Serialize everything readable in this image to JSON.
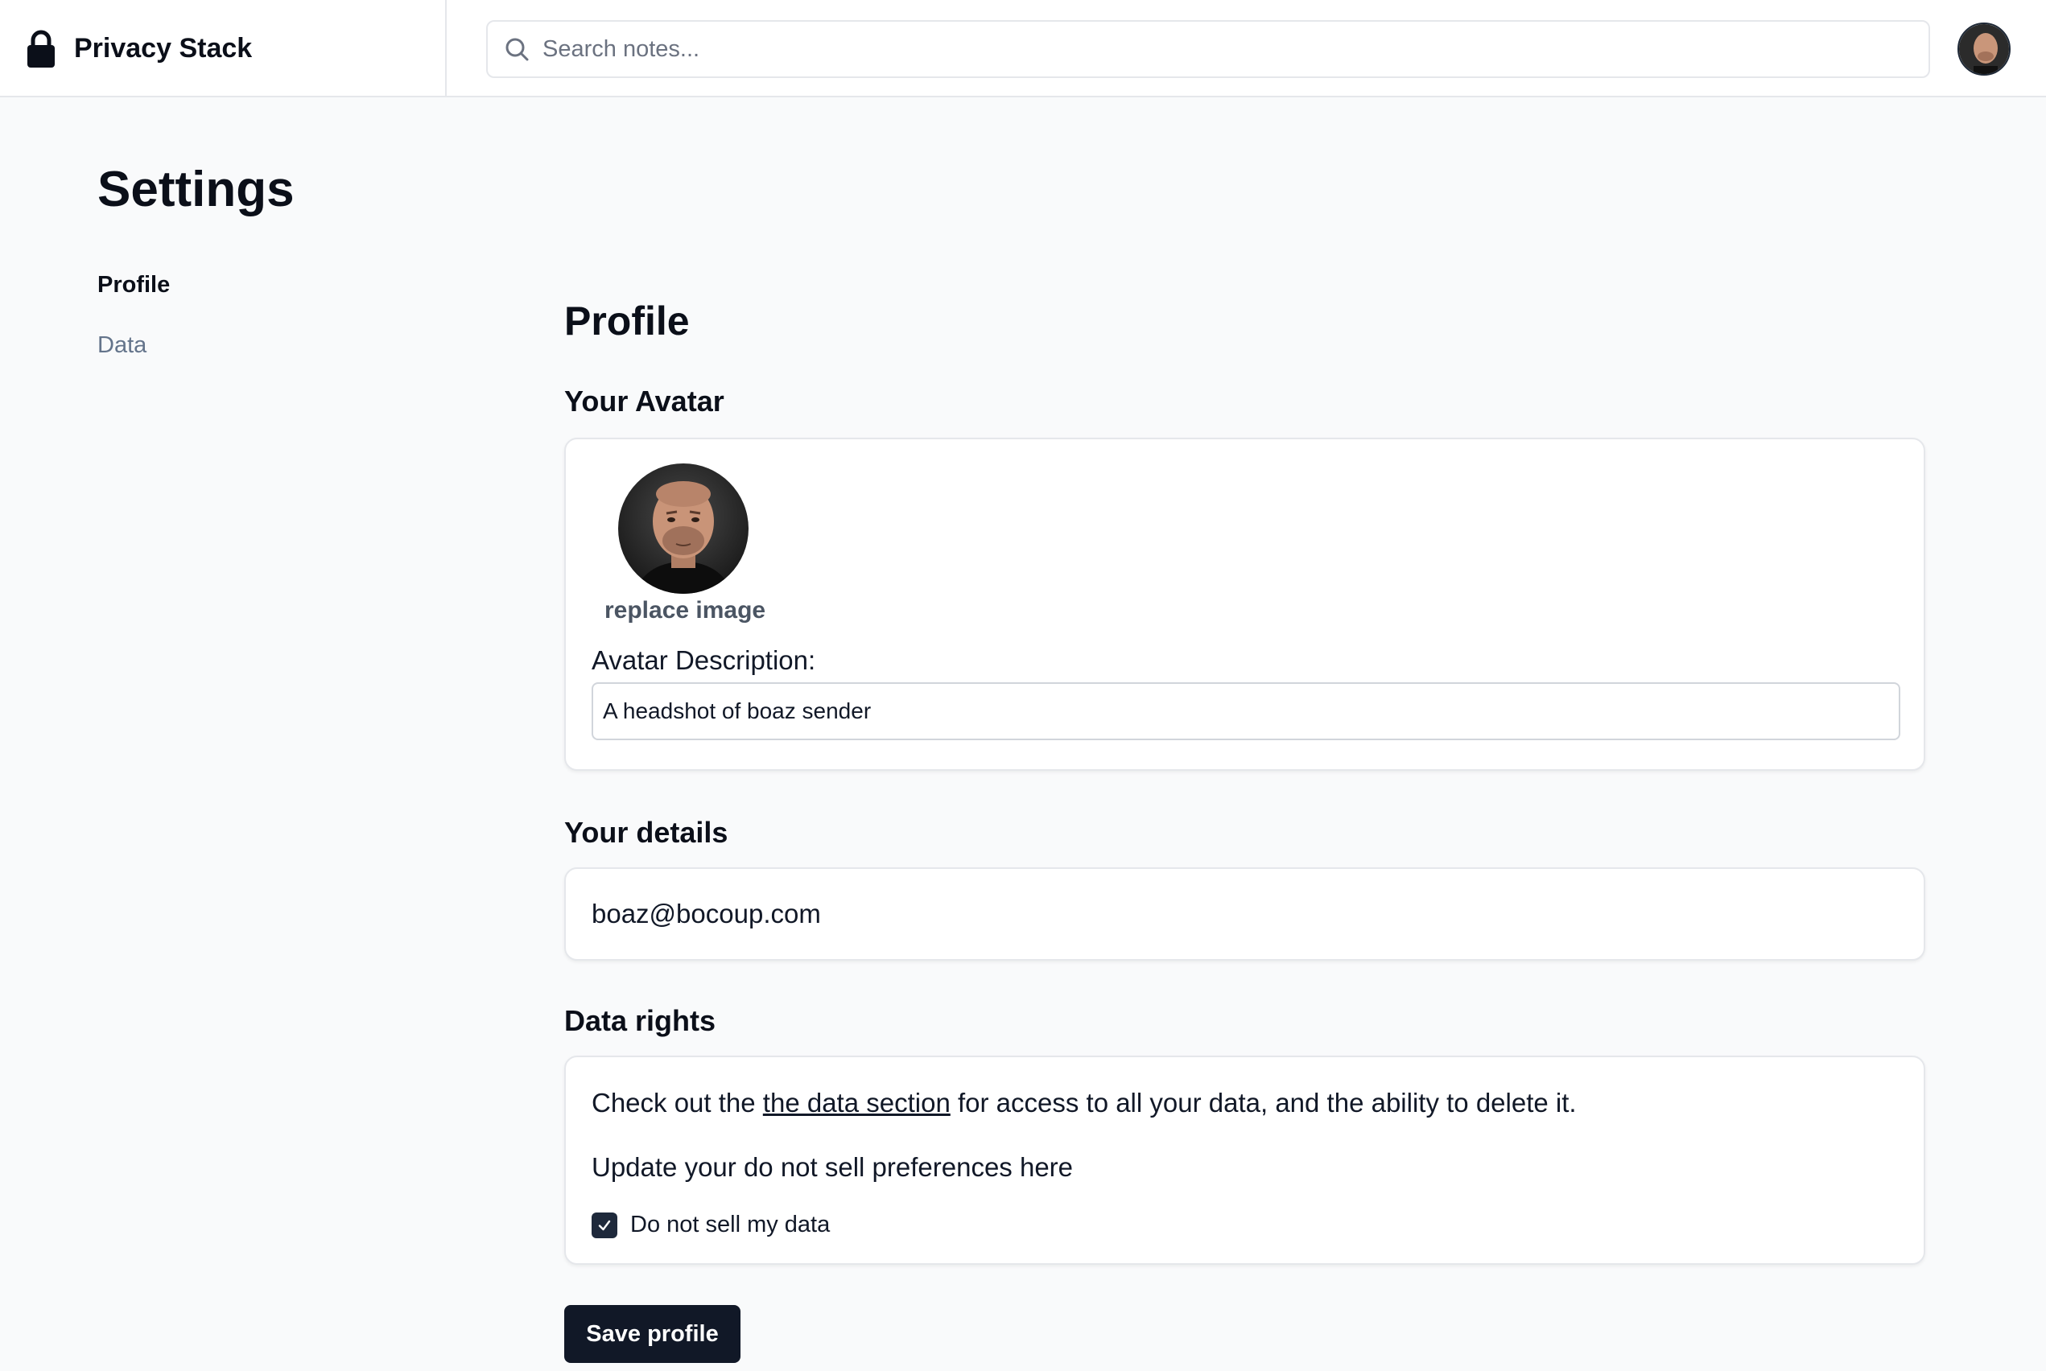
{
  "app": {
    "name": "Privacy Stack"
  },
  "search": {
    "placeholder": "Search notes..."
  },
  "page": {
    "title": "Settings"
  },
  "sidebar": {
    "items": [
      {
        "label": "Profile",
        "active": true
      },
      {
        "label": "Data",
        "active": false
      }
    ]
  },
  "profile": {
    "heading": "Profile",
    "avatar": {
      "title": "Your Avatar",
      "replace_label": "replace image",
      "description_label": "Avatar Description:",
      "description_value": "A headshot of boaz sender"
    },
    "details": {
      "title": "Your details",
      "email": "boaz@bocoup.com"
    },
    "data_rights": {
      "title": "Data rights",
      "text_before": "Check out the ",
      "link_text": "the data section",
      "text_after": " for access to all your data, and the ability to delete it.",
      "preferences_text": "Update your do not sell preferences here",
      "checkbox_label": "Do not sell my data",
      "checkbox_checked": true
    },
    "save_label": "Save profile"
  },
  "colors": {
    "primary": "#111827",
    "muted": "#64748b",
    "border": "#e5e7eb",
    "background": "#f9fafb"
  }
}
